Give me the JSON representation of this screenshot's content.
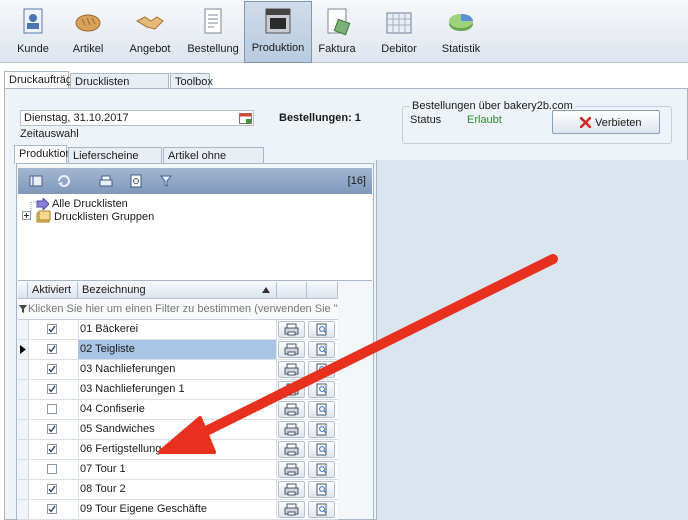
{
  "toolbar": {
    "items": [
      {
        "label": "Kunde",
        "icon": "customer-card-icon",
        "active": false
      },
      {
        "label": "Artikel",
        "icon": "bread-icon",
        "active": false
      },
      {
        "label": "Angebot",
        "icon": "handshake-icon",
        "active": false
      },
      {
        "label": "Bestellung",
        "icon": "order-form-icon",
        "active": false
      },
      {
        "label": "Produktion",
        "icon": "oven-icon",
        "active": true
      },
      {
        "label": "Faktura",
        "icon": "invoice-icon",
        "active": false
      },
      {
        "label": "Debitor",
        "icon": "debitor-calendar-icon",
        "active": false
      },
      {
        "label": "Statistik",
        "icon": "pie-chart-icon",
        "active": false
      }
    ]
  },
  "main_tabs": [
    "Druckaufträge",
    "Drucklisten bearbeiten",
    "Toolbox"
  ],
  "date": {
    "value": "Dienstag, 31.10.2017",
    "caption": "Zeitauswahl"
  },
  "orders": {
    "label": "Bestellungen: 1"
  },
  "b2b": {
    "title": "Bestellungen über bakery2b.com",
    "status_label": "Status",
    "status_value": "Erlaubt",
    "button_label": "Verbieten"
  },
  "sub_tabs": [
    "Produktion",
    "Lieferscheine drucken",
    "Artikel ohne Zuordnung"
  ],
  "inner_toolbar": {
    "count": "[16]"
  },
  "tree": {
    "items": [
      "Alle Drucklisten",
      "Drucklisten Gruppen"
    ]
  },
  "grid": {
    "headers": {
      "active": "Aktiviert",
      "name": "Bezeichnung"
    },
    "filter_hint": "Klicken Sie hier um einen Filter zu bestimmen (verwenden Sie \"%\" als erstes Ze",
    "rows": [
      {
        "name": "01 Bäckerei",
        "checked": true,
        "selected": false
      },
      {
        "name": "02 Teigliste",
        "checked": true,
        "selected": true
      },
      {
        "name": "03 Nachlieferungen",
        "checked": true,
        "selected": false
      },
      {
        "name": "03 Nachlieferungen 1",
        "checked": true,
        "selected": false
      },
      {
        "name": "04 Confiserie",
        "checked": false,
        "selected": false
      },
      {
        "name": "05 Sandwiches",
        "checked": true,
        "selected": false
      },
      {
        "name": "06 Fertigstellung",
        "checked": true,
        "selected": false
      },
      {
        "name": "07 Tour 1",
        "checked": false,
        "selected": false
      },
      {
        "name": "08 Tour 2",
        "checked": true,
        "selected": false
      },
      {
        "name": "09 Tour Eigene Geschäfte",
        "checked": true,
        "selected": false
      }
    ]
  },
  "colors": {
    "accent_arrow": "#e8301f",
    "status_ok": "#2e8b2e",
    "selected_row": "#a9c4e4"
  }
}
